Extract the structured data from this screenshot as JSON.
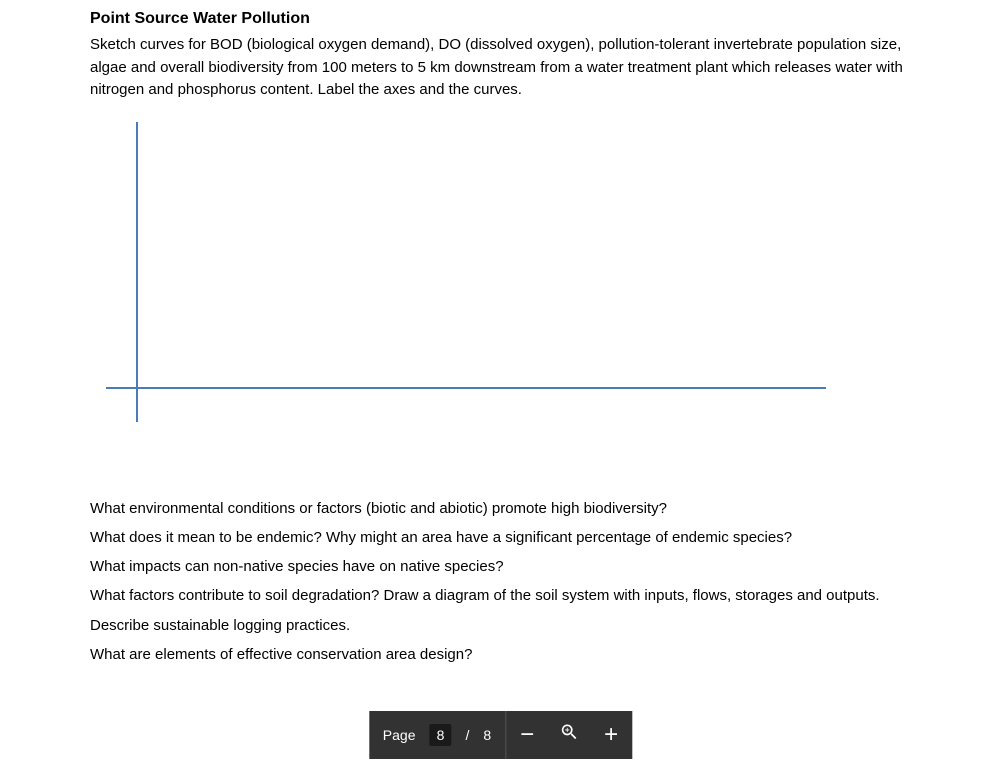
{
  "document": {
    "title": "Point Source Water Pollution",
    "instructions": "Sketch curves for BOD (biological oxygen demand), DO (dissolved oxygen), pollution-tolerant invertebrate population size, algae and overall biodiversity from 100 meters to 5 km downstream from a water treatment plant which releases water with nitrogen and phosphorus content. Label the axes and the curves.",
    "questions": [
      "What environmental conditions or factors (biotic and abiotic) promote high biodiversity?",
      "What does it mean to be endemic?  Why might an area have a significant percentage of endemic species?",
      "What impacts can non-native species have on native species?",
      "What factors contribute to soil degradation?  Draw a diagram of the soil system with inputs, flows, storages and outputs.",
      "Describe sustainable logging practices.",
      "What are elements of effective conservation area design?"
    ]
  },
  "toolbar": {
    "page_label": "Page",
    "current_page": "8",
    "separator": "/",
    "total_pages": "8"
  }
}
